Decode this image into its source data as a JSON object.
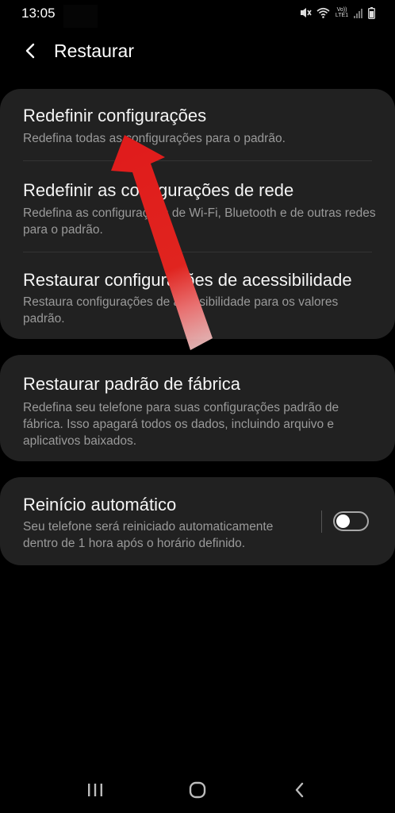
{
  "status_bar": {
    "time": "13:05",
    "network_label": "Vo)) LTE1"
  },
  "header": {
    "title": "Restaurar"
  },
  "items": [
    {
      "title": "Redefinir configurações",
      "subtitle": "Redefina todas as configurações para o padrão."
    },
    {
      "title": "Redefinir as configurações de rede",
      "subtitle": "Redefina as configurações de Wi-Fi, Bluetooth e de outras redes para o padrão."
    },
    {
      "title": "Restaurar configurações de acessibilidade",
      "subtitle": "Restaura configurações de acessibilidade para os valores padrão."
    },
    {
      "title": "Restaurar padrão de fábrica",
      "subtitle": "Redefina seu telefone para suas configurações padrão de fábrica. Isso apagará todos os dados, incluindo arquivo e aplicativos baixados."
    },
    {
      "title": "Reinício automático",
      "subtitle": "Seu telefone será reiniciado automaticamente dentro de 1 hora após o horário definido.",
      "toggle_on": false
    }
  ],
  "icons": {
    "back": "chevron-left-icon",
    "mute": "mute-icon",
    "wifi": "wifi-icon",
    "signal": "signal-icon",
    "battery": "battery-icon",
    "recents": "recents-icon",
    "home": "home-icon",
    "nav_back": "nav-back-icon"
  },
  "colors": {
    "background": "#000000",
    "card": "#212121",
    "annotation_arrow": "#e01b1b"
  }
}
